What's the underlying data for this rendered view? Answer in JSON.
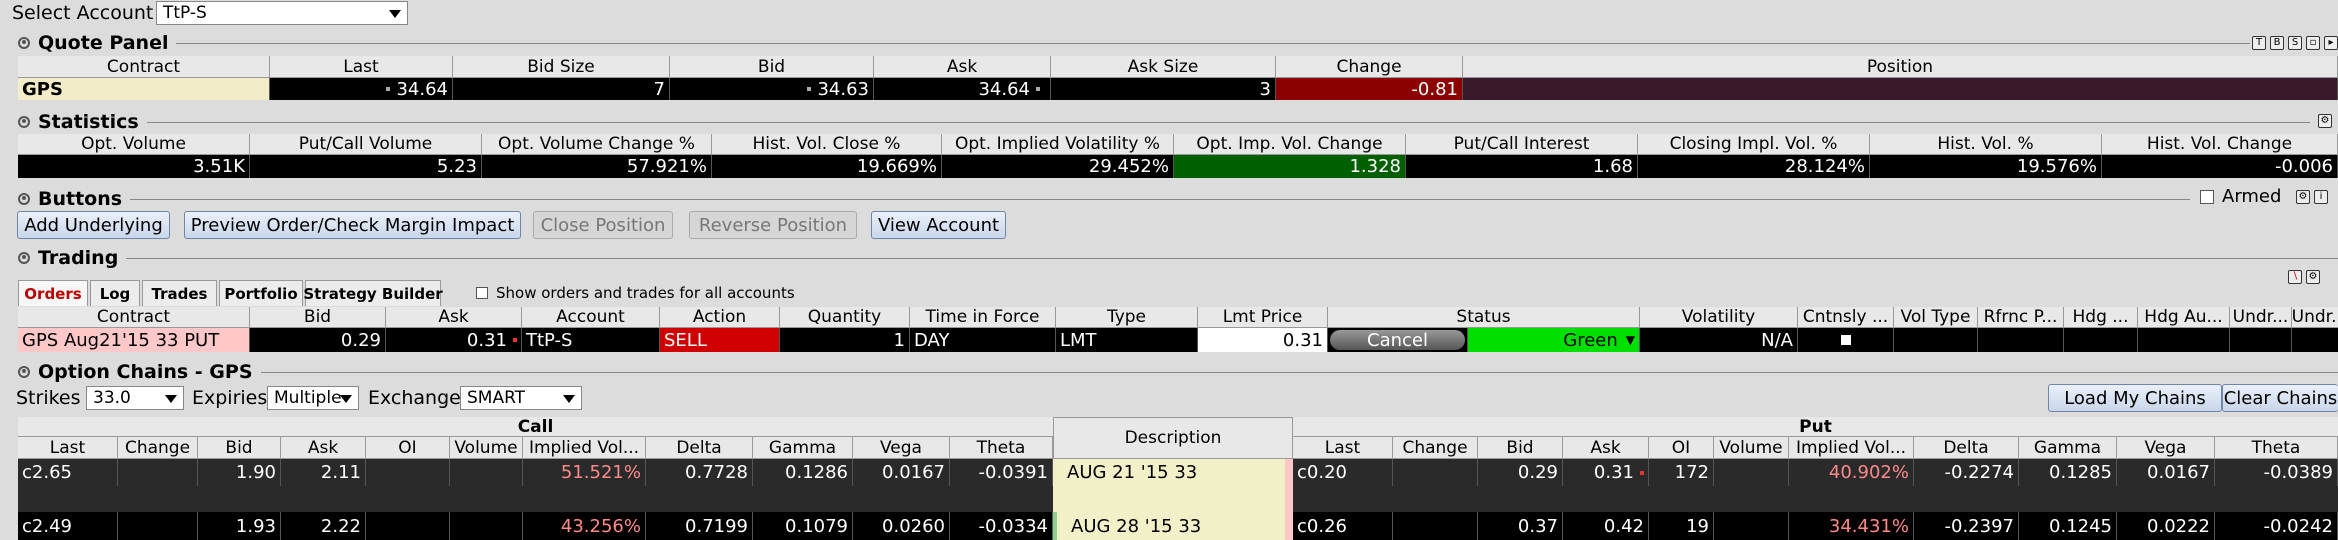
{
  "account": {
    "label": "Select Account",
    "value": "TtP-S"
  },
  "quote_panel": {
    "title": "Quote Panel",
    "headers": [
      "Contract",
      "Last",
      "Bid Size",
      "Bid",
      "Ask",
      "Ask Size",
      "Change",
      "Position"
    ],
    "row": {
      "contract": "GPS",
      "last": "34.64",
      "bid_size": "7",
      "bid": "34.63",
      "ask": "34.64",
      "ask_size": "3",
      "change": "-0.81",
      "position": ""
    }
  },
  "statistics": {
    "title": "Statistics",
    "headers": [
      "Opt. Volume",
      "Put/Call Volume",
      "Opt. Volume Change %",
      "Hist. Vol. Close %",
      "Opt. Implied Volatility %",
      "Opt. Imp. Vol. Change",
      "Put/Call Interest",
      "Closing Impl. Vol. %",
      "Hist. Vol. %",
      "Hist. Vol. Change"
    ],
    "values": [
      "3.51K",
      "5.23",
      "57.921%",
      "19.669%",
      "29.452%",
      "1.328",
      "1.68",
      "28.124%",
      "19.576%",
      "-0.006"
    ]
  },
  "buttons": {
    "title": "Buttons",
    "armed_label": "Armed",
    "items": [
      "Add Underlying",
      "Preview Order/Check Margin Impact",
      "Close Position",
      "Reverse Position",
      "View Account"
    ]
  },
  "trading": {
    "title": "Trading",
    "tabs": [
      "Orders",
      "Log",
      "Trades",
      "Portfolio",
      "Strategy Builder"
    ],
    "show_all_label": "Show orders and trades for all accounts",
    "headers": [
      "Contract",
      "Bid",
      "Ask",
      "Account",
      "Action",
      "Quantity",
      "Time in Force",
      "Type",
      "Lmt Price",
      "Status",
      "Volatility",
      "Cntnsly ...",
      "Vol Type",
      "Rfrnc P...",
      "Hdg ...",
      "Hdg Au...",
      "Undr...",
      "Undr..."
    ],
    "order": {
      "contract": "GPS Aug21'15 33 PUT",
      "bid": "0.29",
      "ask": "0.31",
      "account": "TtP-S",
      "action": "SELL",
      "quantity": "1",
      "tif": "DAY",
      "type": "LMT",
      "lmt_price": "0.31",
      "cancel_label": "Cancel",
      "status": "Green",
      "volatility": "N/A"
    }
  },
  "option_chains": {
    "title": "Option Chains - GPS",
    "strikes_label": "Strikes",
    "strikes_value": "33.0",
    "expiries_label": "Expiries",
    "expiries_value": "Multiple",
    "exchange_label": "Exchange",
    "exchange_value": "SMART",
    "load_label": "Load My Chains",
    "clear_label": "Clear Chains",
    "call_label": "Call",
    "put_label": "Put",
    "desc_label": "Description",
    "col_headers": [
      "Last",
      "Change",
      "Bid",
      "Ask",
      "OI",
      "Volume",
      "Implied Vol...",
      "Delta",
      "Gamma",
      "Vega",
      "Theta"
    ],
    "rows": [
      {
        "desc": "AUG 21 '15 33",
        "call": [
          "c2.65",
          "",
          "1.90",
          "2.11",
          "",
          "",
          "51.521%",
          "0.7728",
          "0.1286",
          "0.0167",
          "-0.0391"
        ],
        "put": [
          "c0.20",
          "",
          "0.29",
          "0.31",
          "172",
          "",
          "40.902%",
          "-0.2274",
          "0.1285",
          "0.0167",
          "-0.0389"
        ]
      },
      {
        "desc": "AUG 28 '15 33",
        "call": [
          "c2.49",
          "",
          "1.93",
          "2.22",
          "",
          "",
          "43.256%",
          "0.7199",
          "0.1079",
          "0.0260",
          "-0.0334"
        ],
        "put": [
          "c0.26",
          "",
          "0.37",
          "0.42",
          "19",
          "",
          "34.431%",
          "-0.2397",
          "0.1245",
          "0.0222",
          "-0.0242"
        ]
      }
    ]
  },
  "colors": {
    "change_bg": "#8b0000",
    "position_bg": "#3a1a2a",
    "green": "#00e000",
    "sell_bg": "#d00000",
    "implied_vol": "#ff8a8a"
  }
}
